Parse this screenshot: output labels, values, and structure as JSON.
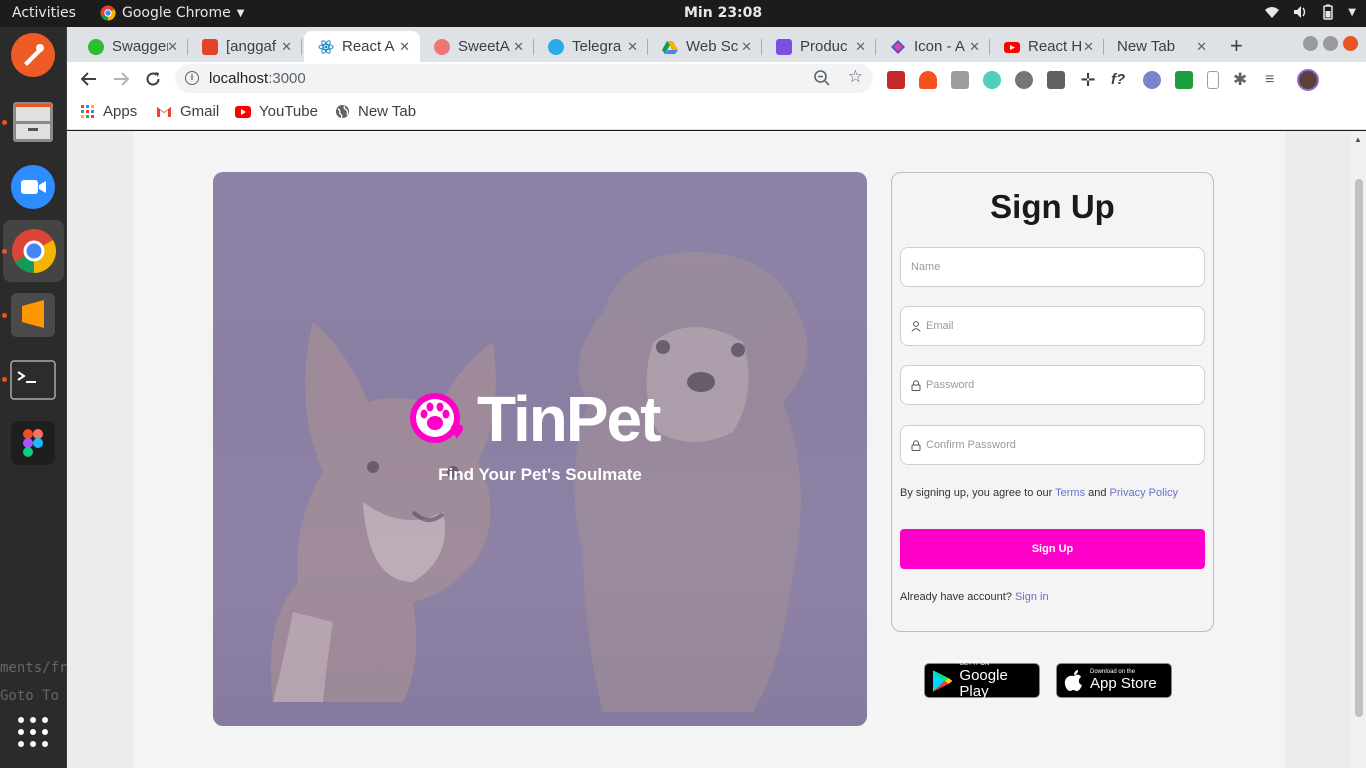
{
  "topbar": {
    "activities": "Activities",
    "app_name": "Google Chrome",
    "clock": "Min 23:08"
  },
  "dock": {
    "items": [
      "postman",
      "files",
      "zoom",
      "chrome",
      "sublime-text",
      "terminal",
      "figma"
    ],
    "ghost_text_1": "ments/fr",
    "ghost_text_2": "Goto  To"
  },
  "browser": {
    "tabs": [
      {
        "title": "Swagger",
        "color": "#2dbd2d"
      },
      {
        "title": "[anggaf",
        "color": "#e24329"
      },
      {
        "title": "React A",
        "color": "#61dafb",
        "active": true
      },
      {
        "title": "SweetA",
        "color": "#f27474"
      },
      {
        "title": "Telegra",
        "color": "#2aabee"
      },
      {
        "title": "Web Sc",
        "color": "#f5b400"
      },
      {
        "title": "Produc",
        "color": "#7b4fe0"
      },
      {
        "title": "Icon - A",
        "color": "#5a4fcf"
      },
      {
        "title": "React H",
        "color": "#ff0000"
      },
      {
        "title": "New Tab",
        "color": ""
      }
    ],
    "url_host": "localhost",
    "url_port": ":3000",
    "bookmarks": [
      {
        "label": "Apps",
        "icon": "apps-grid-icon"
      },
      {
        "label": "Gmail",
        "icon": "gmail-icon"
      },
      {
        "label": "YouTube",
        "icon": "youtube-icon"
      },
      {
        "label": "New Tab",
        "icon": "globe-icon"
      }
    ]
  },
  "hero": {
    "brand": "TinPet",
    "tagline": "Find Your Pet's Soulmate",
    "accent": "#ff00c8"
  },
  "form": {
    "title": "Sign Up",
    "name_placeholder": "Name",
    "email_placeholder": "Email",
    "password_placeholder": "Password",
    "confirm_placeholder": "Confirm Password",
    "terms_prefix": "By signing up, you agree to our ",
    "terms_link": "Terms",
    "terms_and": " and ",
    "privacy_link": "Privacy Policy",
    "submit_label": "Sign Up",
    "already_text": "Already have account? ",
    "signin_link": "Sign in"
  },
  "stores": {
    "google_small": "GET IT ON",
    "google_big": "Google Play",
    "apple_small": "Download on the",
    "apple_big": "App Store"
  }
}
